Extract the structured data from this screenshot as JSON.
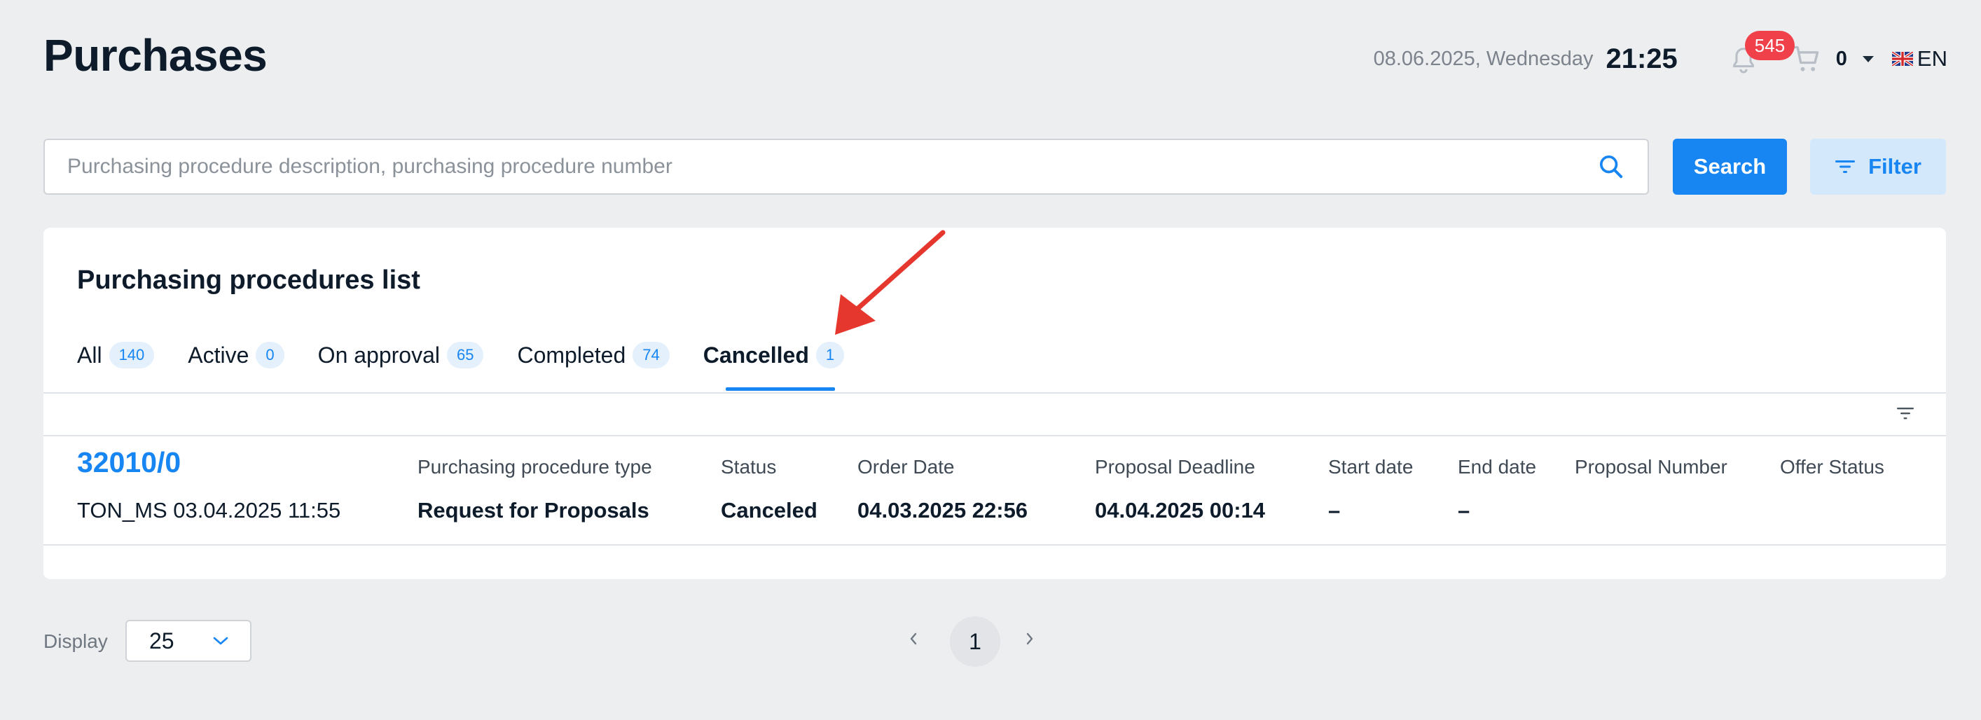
{
  "header": {
    "title": "Purchases",
    "date": "08.06.2025, Wednesday",
    "time": "21:25",
    "notifications_count": "545",
    "cart_count": "0",
    "language": "EN"
  },
  "search": {
    "placeholder": "Purchasing procedure description, purchasing procedure number",
    "value": "",
    "search_button": "Search",
    "filter_button": "Filter"
  },
  "list": {
    "title": "Purchasing procedures list",
    "tabs": [
      {
        "label": "All",
        "count": "140"
      },
      {
        "label": "Active",
        "count": "0"
      },
      {
        "label": "On approval",
        "count": "65"
      },
      {
        "label": "Completed",
        "count": "74"
      },
      {
        "label": "Cancelled",
        "count": "1"
      }
    ],
    "active_tab": "Cancelled",
    "columns": {
      "type": "Purchasing procedure type",
      "status": "Status",
      "order_date": "Order Date",
      "deadline": "Proposal Deadline",
      "start": "Start date",
      "end": "End date",
      "proposal_number": "Proposal Number",
      "offer_status": "Offer Status"
    },
    "rows": [
      {
        "id": "32010/0",
        "sub": "TON_MS 03.04.2025 11:55",
        "type": "Request for Proposals",
        "status": "Canceled",
        "order_date": "04.03.2025 22:56",
        "deadline": "04.04.2025 00:14",
        "start": "–",
        "end": "–",
        "proposal_number": "",
        "offer_status": ""
      }
    ]
  },
  "footer": {
    "display_label": "Display",
    "display_value": "25",
    "current_page": "1"
  },
  "colors": {
    "accent": "#1785f2",
    "badge": "#f0404a",
    "annotation_arrow": "#e5372d"
  },
  "icons": [
    "bell-icon",
    "cart-icon",
    "uk-flag-icon",
    "search-icon",
    "filter-icon",
    "sort-icon",
    "chevron-down-icon",
    "chevron-left-icon",
    "chevron-right-icon",
    "arrow-annotation"
  ]
}
